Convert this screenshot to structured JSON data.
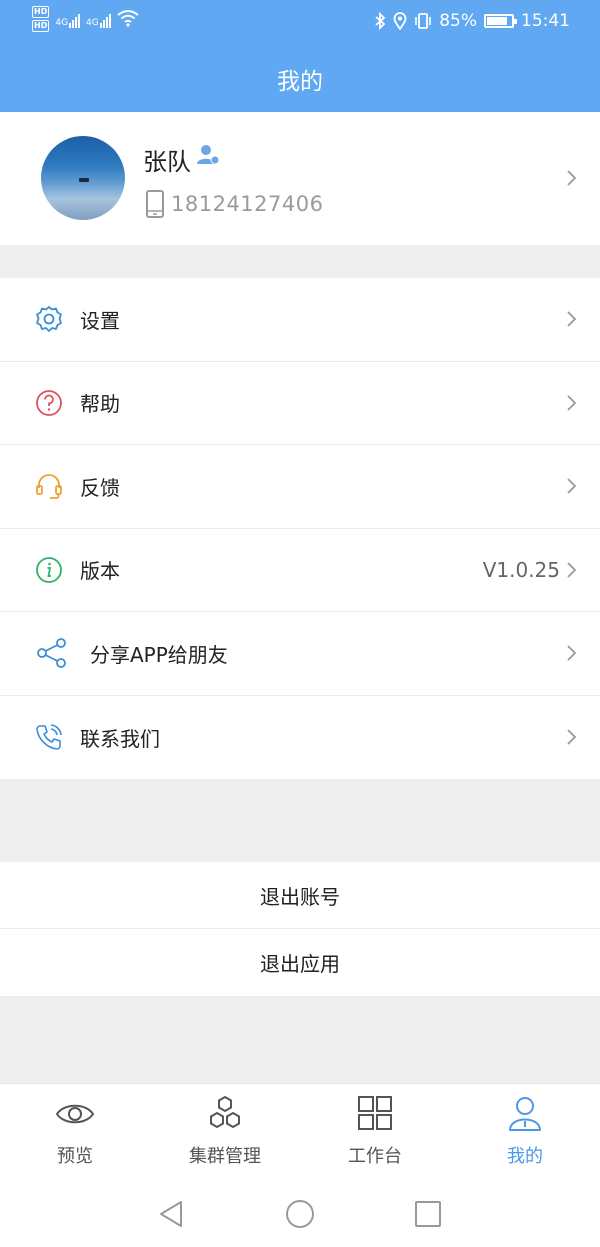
{
  "status_bar": {
    "hd1": "HD",
    "hd2": "HD",
    "net1": "4G",
    "net2": "4G",
    "battery": "85%",
    "battery_level": 0.85,
    "time": "15:41"
  },
  "header": {
    "title": "我的"
  },
  "profile": {
    "name": "张队",
    "phone": "18124127406"
  },
  "menu": [
    {
      "icon": "gear-icon",
      "label": "设置",
      "value": "",
      "color": "#3a8fd9"
    },
    {
      "icon": "question-icon",
      "label": "帮助",
      "value": "",
      "color": "#e0505a"
    },
    {
      "icon": "headset-icon",
      "label": "反馈",
      "value": "",
      "color": "#f0a030"
    },
    {
      "icon": "info-icon",
      "label": "版本",
      "value": "V1.0.25",
      "color": "#2fb36a"
    },
    {
      "icon": "share-icon",
      "label": "分享APP给朋友",
      "value": "",
      "color": "#3a8fd9"
    },
    {
      "icon": "phone-call-icon",
      "label": "联系我们",
      "value": "",
      "color": "#3a8fd9"
    }
  ],
  "actions": {
    "logout_account": "退出账号",
    "exit_app": "退出应用"
  },
  "tabs": [
    {
      "icon": "eye-icon",
      "label": "预览",
      "active": false
    },
    {
      "icon": "hexagons-icon",
      "label": "集群管理",
      "active": false
    },
    {
      "icon": "grid-icon",
      "label": "工作台",
      "active": false
    },
    {
      "icon": "user-icon",
      "label": "我的",
      "active": true
    }
  ],
  "colors": {
    "primary": "#60a9f2",
    "active_tab": "#4a9ae6"
  }
}
